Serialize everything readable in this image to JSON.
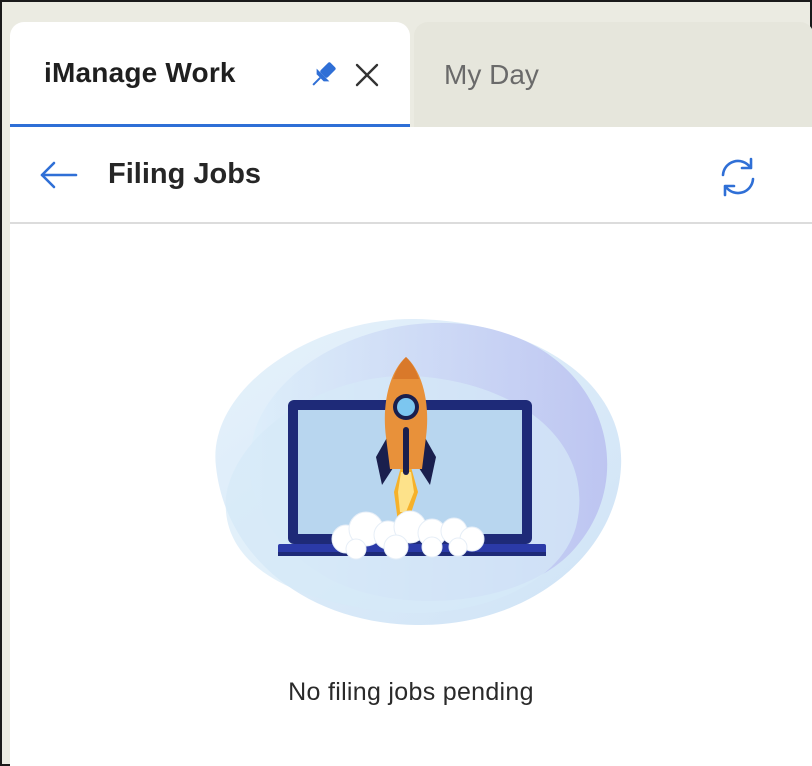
{
  "tabs": [
    {
      "label": "iManage Work",
      "active": true
    },
    {
      "label": "My Day",
      "active": false
    }
  ],
  "tab_icons": {
    "pin": "pin-icon",
    "close": "close-icon"
  },
  "header": {
    "title": "Filing Jobs",
    "back_icon": "arrow-left-icon",
    "refresh_icon": "refresh-icon"
  },
  "empty_state": {
    "message": "No filing jobs pending",
    "illustration": "rocket-launch-laptop"
  },
  "colors": {
    "accent": "#2f6fd6",
    "tab_underline": "#2f6fd6",
    "rocket_orange": "#e8913a",
    "laptop_navy": "#1e2a78"
  }
}
